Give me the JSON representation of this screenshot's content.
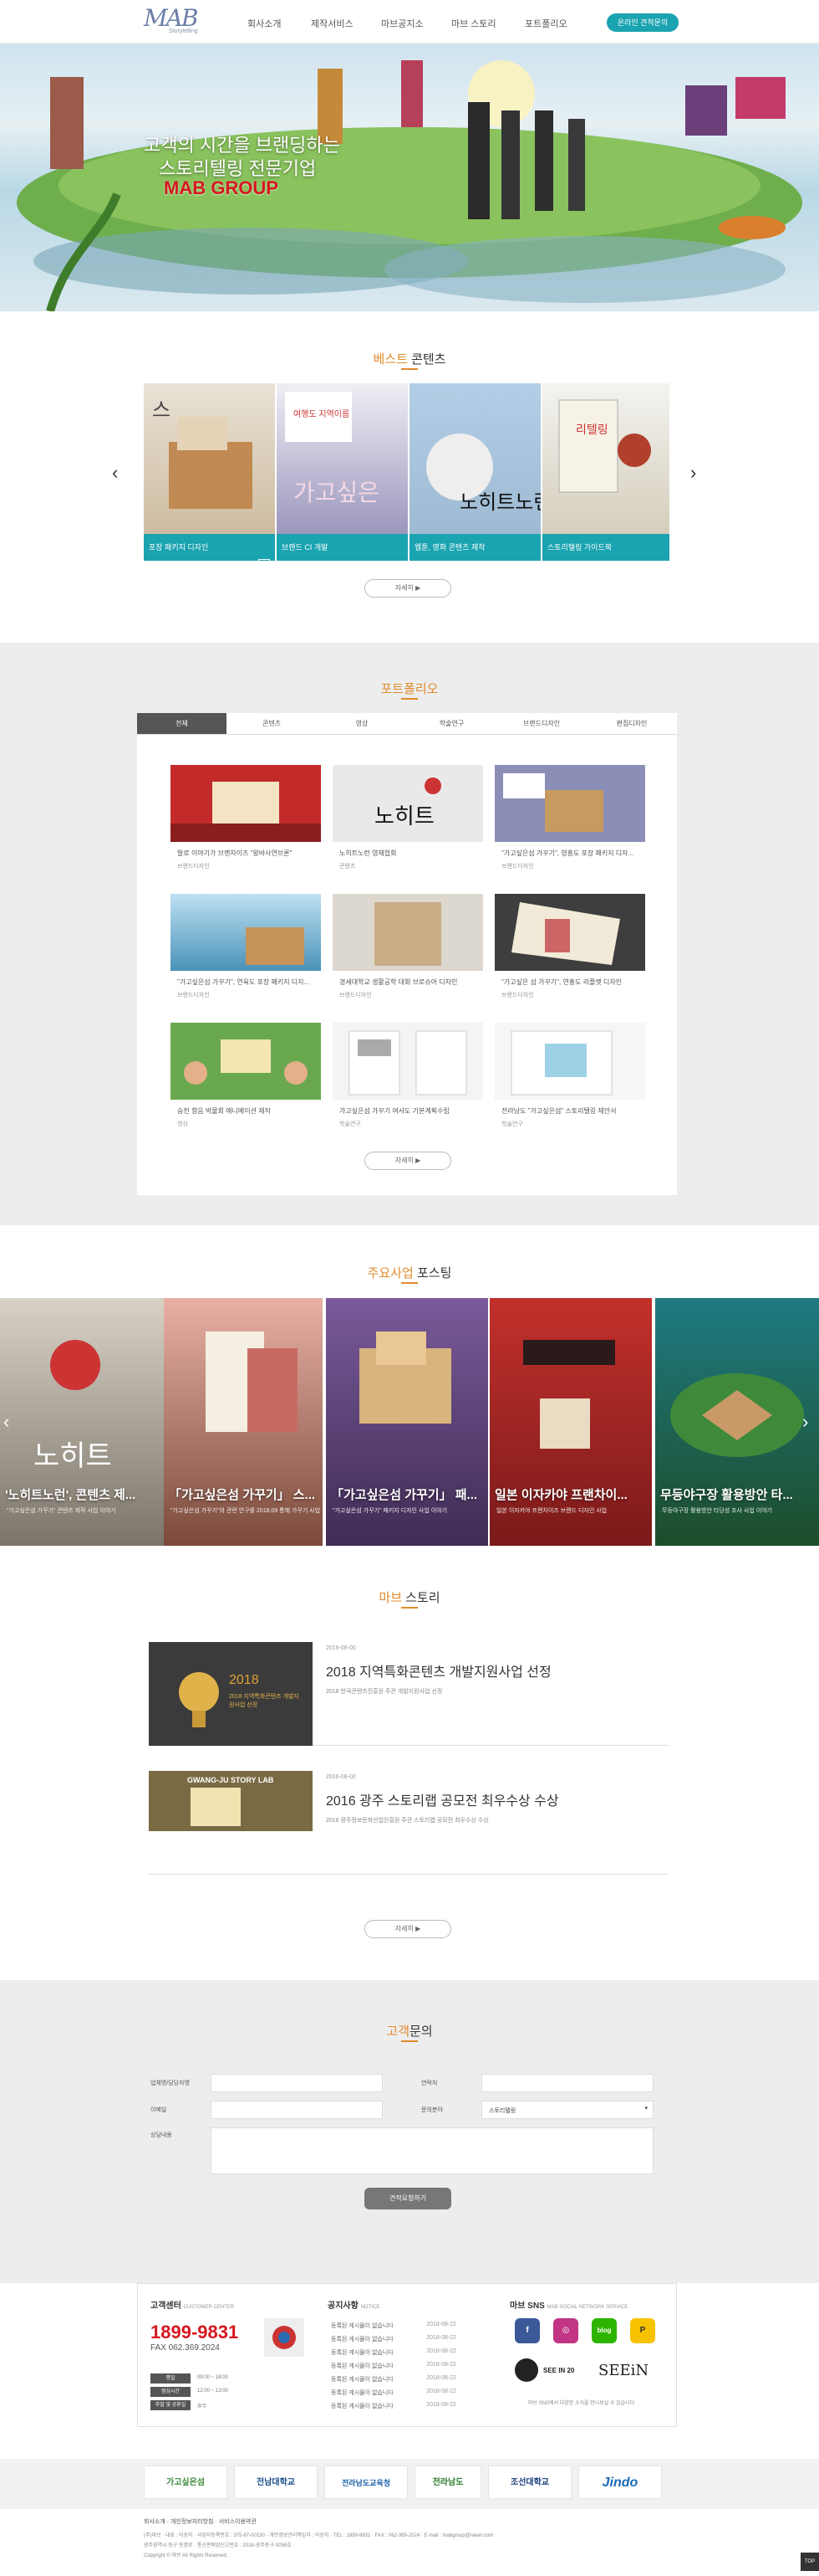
{
  "header": {
    "logo_text": "MAB",
    "logo_sub": "Storytelling",
    "nav": [
      "회사소개",
      "제작서비스",
      "마브공지소",
      "마브 스토리",
      "포트폴리오"
    ],
    "cta": "온라인 견적문의"
  },
  "hero": {
    "line1": "고객의 시간을 브랜딩하는",
    "line2": "스토리텔링 전문기업",
    "line3": "MAB GROUP"
  },
  "best": {
    "title_hl": "베스트",
    "title_rest": " 콘텐츠",
    "cards": [
      "포장 패키지 디자인",
      "브랜드 CI 개발",
      "웹툰, 영화 콘텐츠 제작",
      "스토리텔링 가이드북"
    ],
    "more": "자세히 ▶"
  },
  "portfolio": {
    "title_hl": "포트폴리오",
    "tabs": [
      "전체",
      "콘텐츠",
      "영상",
      "학술연구",
      "브랜드디자인",
      "편집디자인"
    ],
    "items": [
      {
        "t": "발로 이야기가 브랜차이즈 \"왕바사연브론\"",
        "c": "브랜드디자인"
      },
      {
        "t": "노히트노런 영재협회",
        "c": "콘텐츠"
      },
      {
        "t": "\"가고싶은섬 가꾸기\", 영흥도 포장 패키지 디자...",
        "c": "브랜드디자인"
      },
      {
        "t": "\"가고싶은섬 가꾸기\", 연육도 포장 패키지 디지...",
        "c": "브랜드디자인"
      },
      {
        "t": "경세대학교 생활공학 대회 브로슈어 디자인",
        "c": "브랜드디자인"
      },
      {
        "t": "\"가고싶은 섬 가꾸기\", 연홍도 리플렛 디자인",
        "c": "브랜드디자인"
      },
      {
        "t": "승천 향음 박물회 애니메이션 제작",
        "c": "영상"
      },
      {
        "t": "가고싶은섬 가꾸기 여서도 기본계획수립",
        "c": "학술연구"
      },
      {
        "t": "전라남도 \"가고싶은섬\" 스토리텔링 제안서",
        "c": "학술연구"
      }
    ],
    "more": "자세히 ▶"
  },
  "posting": {
    "title_hl": "주요사업",
    "title_rest": " 포스팅",
    "items": [
      {
        "t": "'노히트노런', 콘텐츠 제...",
        "d": "\"가고싶은섬 가꾸기\" 콘텐츠 제작 사업 이야기"
      },
      {
        "t": "「가고싶은섬 가꾸기」 스...",
        "d": "\"가고싶은섬 가꾸기\"의 관련 연구를 2018.09 통해 가꾸기 사업"
      },
      {
        "t": "「가고싶은섬 가꾸기」 패...",
        "d": "\"가고싶은섬 가꾸기\" 패키지 디자인 사업 이야기"
      },
      {
        "t": "일본 이자카야 프랜차이...",
        "d": "일본 이자카야 프랜차이즈 브랜드 디자인 사업"
      },
      {
        "t": "무등야구장 활용방안 타...",
        "d": "무등야구장 활용방안 타당성 조사 사업 이야기"
      }
    ]
  },
  "story": {
    "title_hl": "마브",
    "title_rest": " 스토리",
    "items": [
      {
        "date": "2018-08-00",
        "t": "2018 지역특화콘텐츠 개발지원사업 선정",
        "d": "2018 한국콘텐츠진흥원 주관 개발지원사업 선정",
        "img": "2018 지역특화콘텐츠 개발지원사업 선정"
      },
      {
        "date": "2016-08-00",
        "t": "2016 광주 스토리랩 공모전 최우수상 수상",
        "d": "2016 광주정보문화산업진흥원 주관 스토리랩 공모전 최우수상 수상",
        "img": "GWANG-JU STORY LAB"
      }
    ],
    "more": "자세히 ▶"
  },
  "contact": {
    "title_hl": "고객",
    "title_rest": "문의",
    "company_label": "업체명/담당자명",
    "phone_label": "연락처",
    "email_label": "이메일",
    "type_label": "문의분야",
    "type_value": "스토리텔링",
    "content_label": "상담내용",
    "submit": "견적요청하기"
  },
  "footer": {
    "cs_title": "고객센터",
    "cs_sub": "CUSTOMER CENTER",
    "phone": "1899-9831",
    "fax": "FAX 062.369.2024",
    "hours": [
      "평일",
      "점심시간",
      "주말 및 공휴일"
    ],
    "times": [
      "09:00 ~ 18:00",
      "12:00 ~ 13:00",
      "휴무"
    ],
    "notice_title": "공지사항",
    "notice_sub": "NOTICE",
    "notice_item": "등록된 게시물이 없습니다",
    "notice_date": "2018-08-22",
    "sns_title": "마브 SNS",
    "sns_sub": "MAB SOCIAL NETWORK SERVICE",
    "sns_labels": [
      "f",
      "◎",
      "blog",
      "P"
    ],
    "seein20": "SEE IN 20",
    "seein": "SEEiN",
    "sns_note": "마브 SNS에서 다양한 소식을 만나보실 수 있습니다",
    "partners": [
      "가고싶은섬",
      "전남대학교",
      "전라남도교육청",
      "전라남도",
      "조선대학교",
      "Jindo"
    ],
    "foot_links": "회사소개 · 개인정보처리방침 · 서비스이용약관",
    "foot_co": "(주)마브 · 대표 : 이승하 · 사업자등록번호 : 375-87-00130 · 개인정보관리책임자 : 이승하 · TEL : 1899-9831 · FAX : 062-369-2024 · E-mail : mabgroup@naver.com",
    "foot_addr": "광주광역시 동구 동명로 · 통신판매업신고번호 : 2018-광주동구-0058호",
    "copy": "Copyright © 마브 All Rights Reserved.",
    "top": "TOP"
  }
}
